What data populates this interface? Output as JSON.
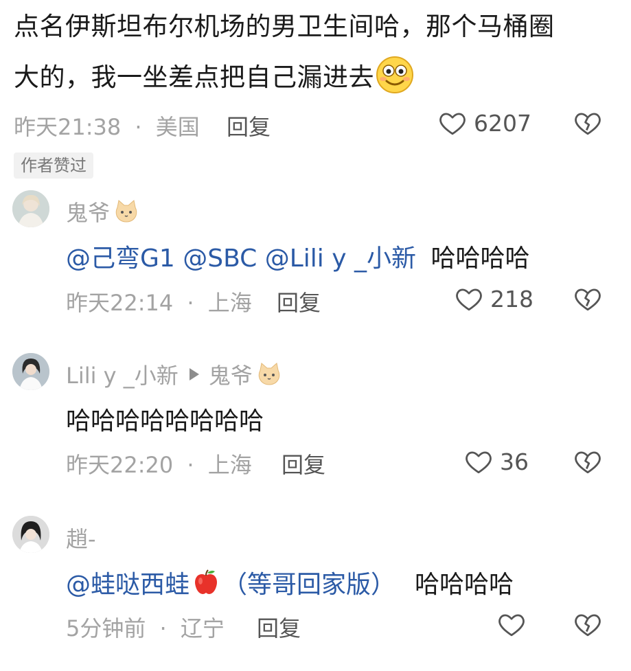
{
  "main_comment": {
    "text_line1": "点名伊斯坦布尔机场的男卫生间哈，那个马桶圈",
    "text_line2": "大的，我一坐差点把自己漏进去",
    "emoji": "smiley-face-icon",
    "time": "昨天21:38",
    "location": "美国",
    "reply_label": "回复",
    "likes": "6207",
    "author_badge": "作者赞过"
  },
  "replies": [
    {
      "name": "鬼爷",
      "mentions": "@己弯G1 @SBC @Lili y _小新",
      "text": "哈哈哈哈",
      "time": "昨天22:14",
      "location": "上海",
      "reply_label": "回复",
      "likes": "218"
    },
    {
      "name": "Lili y _小新",
      "reply_to": "鬼爷",
      "text": "哈哈哈哈哈哈哈哈",
      "time": "昨天22:20",
      "location": "上海",
      "reply_label": "回复",
      "likes": "36"
    },
    {
      "name": "趙-",
      "mentions": "@蛙哒西蛙",
      "mentions_suffix": "（等哥回家版）",
      "text": "哈哈哈哈",
      "time": "5分钟前",
      "location": "辽宁",
      "reply_label": "回复",
      "likes": ""
    }
  ],
  "separator": "·",
  "colors": {
    "mention": "#2b5aa6",
    "meta": "#a3a3a3"
  }
}
